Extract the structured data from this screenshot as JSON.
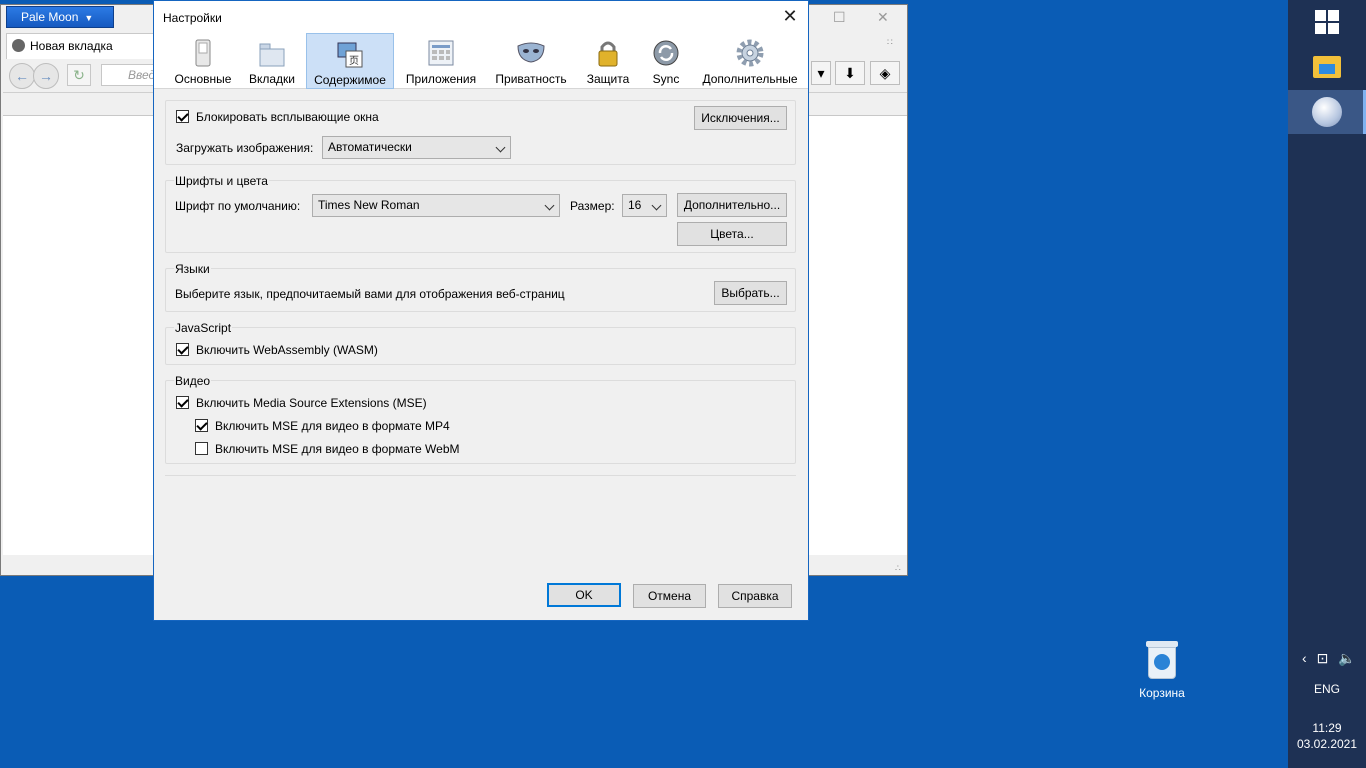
{
  "browser": {
    "menu_button": "Pale Moon",
    "tab_title": "Новая вкладка",
    "url_placeholder": "Введ"
  },
  "taskbar": {
    "language": "ENG",
    "time": "11:29",
    "date": "03.02.2021"
  },
  "desktop": {
    "recycle_bin_label": "Корзина"
  },
  "dialog": {
    "title": "Настройки",
    "tabs": [
      {
        "label": "Основные",
        "icon": "switch-icon"
      },
      {
        "label": "Вкладки",
        "icon": "tabs-icon"
      },
      {
        "label": "Содержимое",
        "icon": "content-icon",
        "selected": true
      },
      {
        "label": "Приложения",
        "icon": "applications-icon"
      },
      {
        "label": "Приватность",
        "icon": "mask-icon"
      },
      {
        "label": "Защита",
        "icon": "padlock-icon"
      },
      {
        "label": "Sync",
        "icon": "sync-icon"
      },
      {
        "label": "Дополнительные",
        "icon": "gear-icon"
      }
    ],
    "popups": {
      "block_label": "Блокировать всплывающие окна",
      "block_checked": true,
      "exceptions_button": "Исключения...",
      "images_label": "Загружать изображения:",
      "images_value": "Автоматически"
    },
    "fonts": {
      "legend": "Шрифты и цвета",
      "default_font_label": "Шрифт по умолчанию:",
      "default_font_value": "Times New Roman",
      "size_label": "Размер:",
      "size_value": "16",
      "advanced_button": "Дополнительно...",
      "colors_button": "Цвета..."
    },
    "languages": {
      "legend": "Языки",
      "description": "Выберите язык, предпочитаемый вами для отображения веб-страниц",
      "choose_button": "Выбрать..."
    },
    "javascript": {
      "legend": "JavaScript",
      "wasm_label": "Включить WebAssembly (WASM)",
      "wasm_checked": true
    },
    "video": {
      "legend": "Видео",
      "mse_label": "Включить Media Source Extensions (MSE)",
      "mse_checked": true,
      "mp4_label": "Включить MSE для видео в формате MP4",
      "mp4_checked": true,
      "webm_label": "Включить MSE для видео в формате WebM",
      "webm_checked": false
    },
    "buttons": {
      "ok": "OK",
      "cancel": "Отмена",
      "help": "Справка"
    }
  }
}
